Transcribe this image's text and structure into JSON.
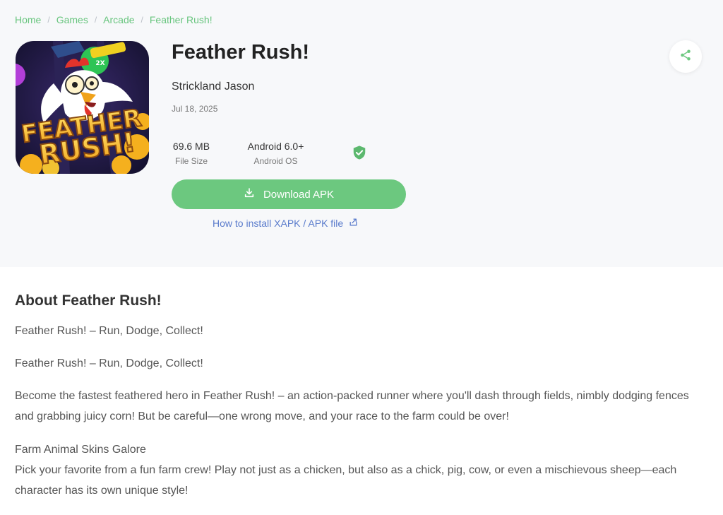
{
  "breadcrumb": [
    {
      "label": "Home"
    },
    {
      "label": "Games"
    },
    {
      "label": "Arcade"
    },
    {
      "label": "Feather Rush!"
    }
  ],
  "app": {
    "title": "Feather Rush!",
    "developer": "Strickland Jason",
    "date": "Jul 18, 2025",
    "icon_text_line1": "FEATHER",
    "icon_text_line2": "RUSH!",
    "icon_badge": "2X"
  },
  "stats": {
    "file_size_value": "69.6 MB",
    "file_size_label": "File Size",
    "os_value": "Android 6.0+",
    "os_label": "Android OS"
  },
  "icons": {
    "share": "share-icon",
    "download": "download-icon",
    "shield": "verified-shield-icon",
    "external": "external-link-icon"
  },
  "actions": {
    "download_label": "Download APK",
    "howto_label": "How to install XAPK / APK file"
  },
  "about": {
    "title": "About Feather Rush!",
    "p1": "Feather Rush! – Run, Dodge, Collect!",
    "p2": "Feather Rush! – Run, Dodge, Collect!",
    "p3": "Become the fastest feathered hero in Feather Rush! – an action-packed runner where you'll dash through fields, nimbly dodging fences and grabbing juicy corn! But be careful—one wrong move, and your race to the farm could be over!",
    "p4_heading": "Farm Animal Skins Galore",
    "p4_body": "Pick your favorite from a fun farm crew! Play not just as a chicken, but also as a chick, pig, cow, or even a mischievous sheep—each character has its own unique style!"
  },
  "colors": {
    "accent_green": "#6cc87f",
    "link_blue": "#5b7ccc",
    "hero_bg": "#f7f8fa"
  }
}
